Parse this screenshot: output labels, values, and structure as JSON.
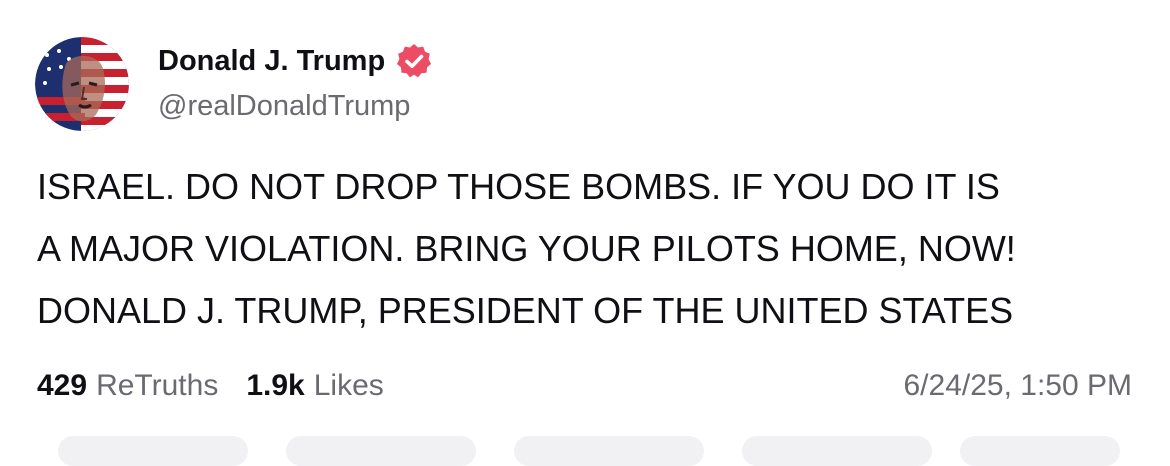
{
  "author": {
    "display_name": "Donald J. Trump",
    "handle": "@realDonaldTrump",
    "verified_icon": "verified-badge-icon",
    "avatar_icon": "profile-avatar"
  },
  "post": {
    "lines": [
      "ISRAEL. DO NOT DROP THOSE BOMBS. IF YOU DO IT IS",
      "A MAJOR VIOLATION. BRING YOUR PILOTS HOME, NOW!",
      "DONALD J. TRUMP, PRESIDENT OF THE UNITED STATES"
    ]
  },
  "stats": {
    "retruths_count": "429",
    "retruths_label": "ReTruths",
    "likes_count": "1.9k",
    "likes_label": "Likes"
  },
  "timestamp": "6/24/25, 1:50 PM",
  "colors": {
    "text": "#0f0f14",
    "muted": "#6b6a70",
    "verified": "#ec4d65"
  }
}
